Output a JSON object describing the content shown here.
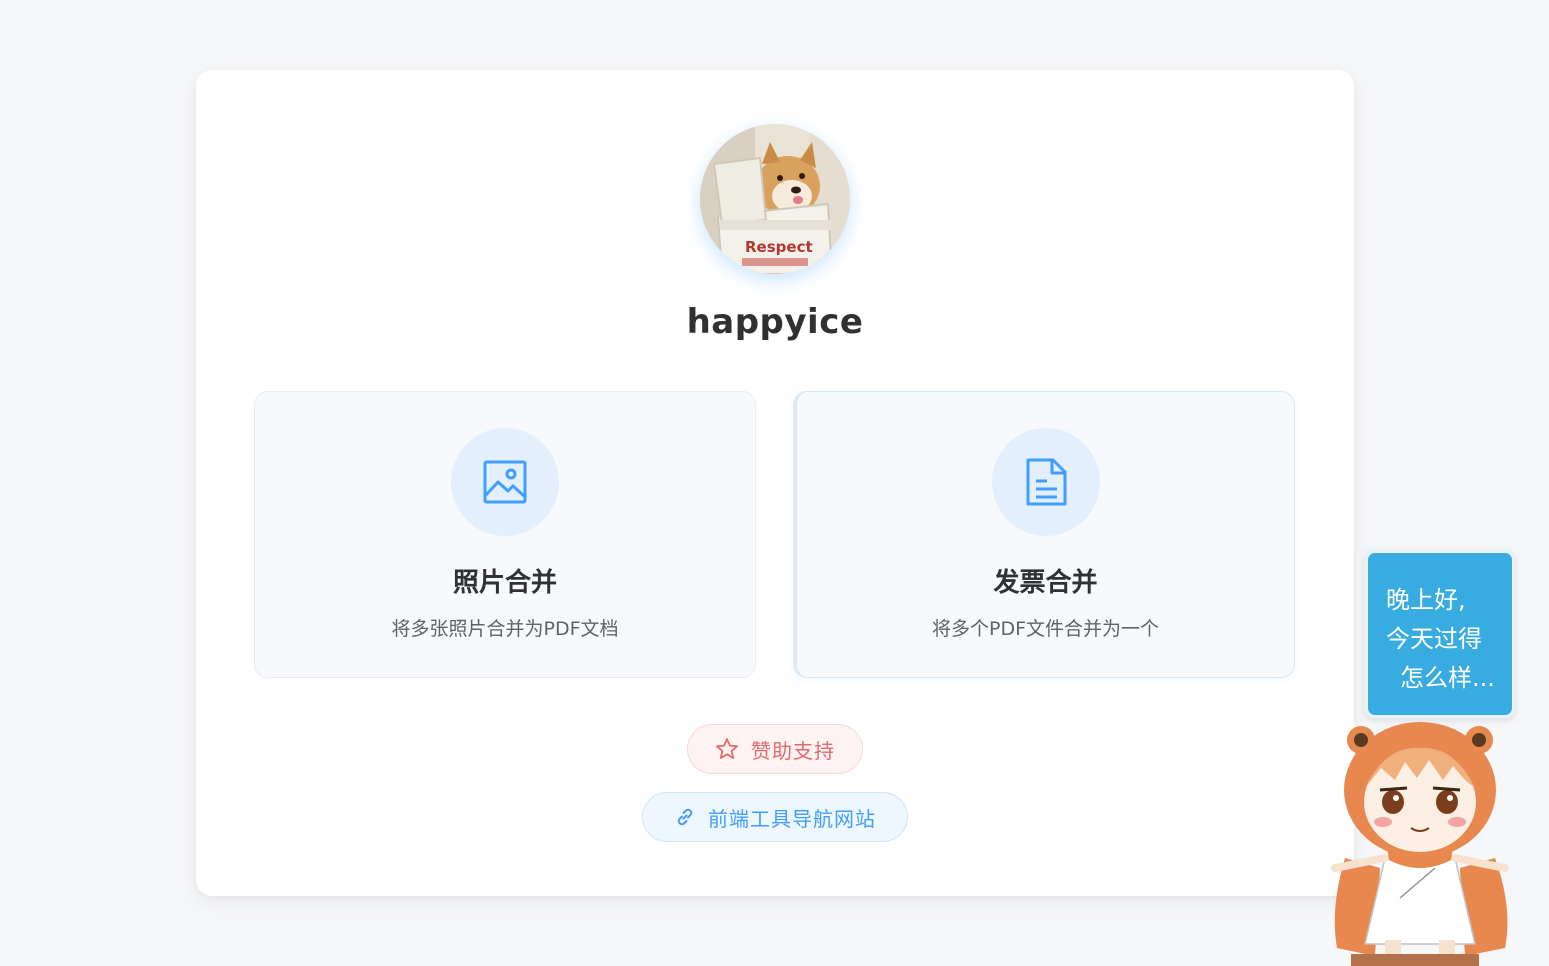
{
  "profile": {
    "username": "happyice",
    "avatar_caption": "Respect"
  },
  "features": [
    {
      "title": "照片合并",
      "description": "将多张照片合并为PDF文档",
      "icon": "image-icon"
    },
    {
      "title": "发票合并",
      "description": "将多个PDF文件合并为一个",
      "icon": "document-icon"
    }
  ],
  "actions": {
    "sponsor_label": "赞助支持",
    "sponsor_icon": "star-icon",
    "nav_label": "前端工具导航网站",
    "nav_icon": "link-icon"
  },
  "mascot": {
    "line1": "晚上好,",
    "line2": "今天过得",
    "line3": "怎么样..."
  },
  "colors": {
    "accent": "#409eff",
    "sponsor": "#e26a6a",
    "chat_bubble": "#38ace0"
  }
}
